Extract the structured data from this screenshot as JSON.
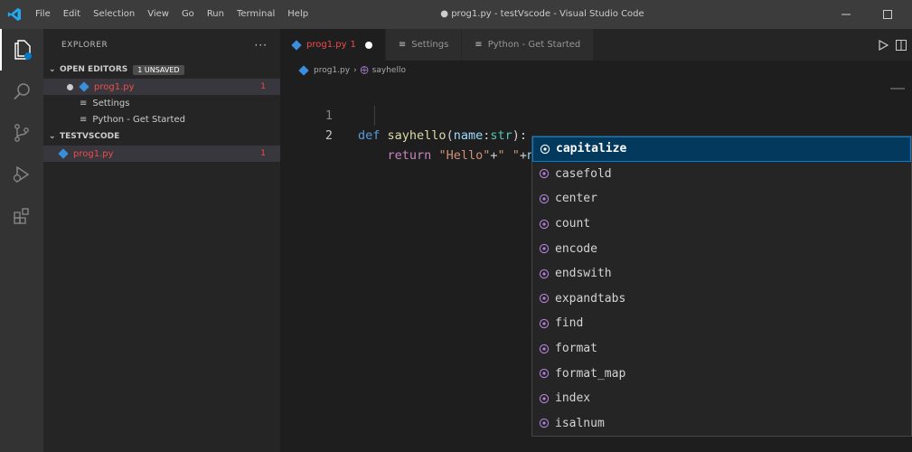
{
  "titlebar": {
    "menu": [
      "File",
      "Edit",
      "Selection",
      "View",
      "Go",
      "Run",
      "Terminal",
      "Help"
    ],
    "window_title": "● prog1.py - testVscode - Visual Studio Code"
  },
  "sidebar": {
    "title": "EXPLORER",
    "more": "···",
    "open_editors": {
      "label": "OPEN EDITORS",
      "badge": "1 UNSAVED",
      "items": [
        "prog1.py",
        "Settings",
        "Python - Get Started"
      ],
      "first_count": "1"
    },
    "workspace": {
      "label": "TESTVSCODE",
      "items": [
        "prog1.py"
      ],
      "first_count": "1"
    }
  },
  "tabs": [
    {
      "label": "prog1.py",
      "suffix": "1"
    },
    {
      "label": "Settings"
    },
    {
      "label": "Python - Get Started"
    }
  ],
  "breadcrumb": {
    "file": "prog1.py",
    "symbol": "sayhello"
  },
  "code": {
    "line_numbers": [
      "1",
      "2"
    ]
  },
  "suggestions": [
    "capitalize",
    "casefold",
    "center",
    "count",
    "encode",
    "endswith",
    "expandtabs",
    "find",
    "format",
    "format_map",
    "index",
    "isalnum"
  ],
  "colors": {
    "accent": "#007fd4",
    "error": "#f14c4c",
    "python": "#3b8edb"
  }
}
